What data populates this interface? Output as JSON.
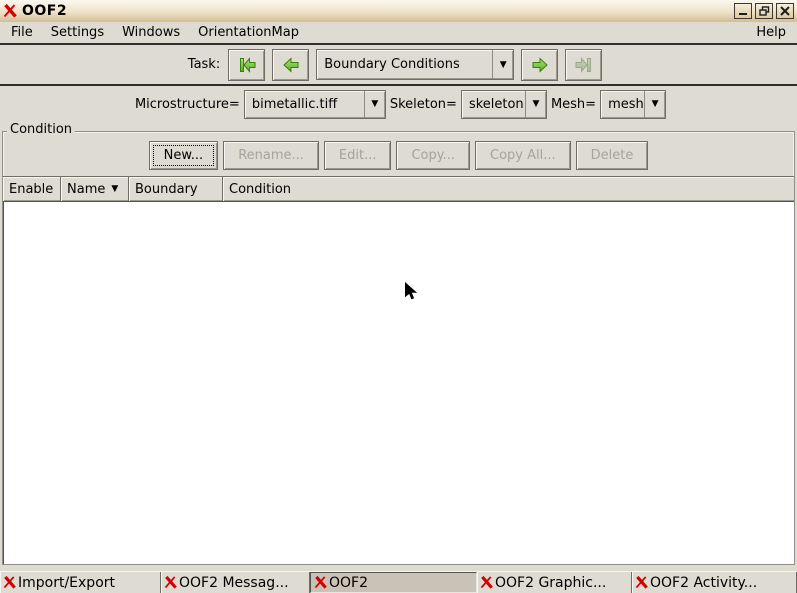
{
  "window": {
    "title": "OOF2"
  },
  "menubar": {
    "items": [
      "File",
      "Settings",
      "Windows",
      "OrientationMap"
    ],
    "help": "Help"
  },
  "task_row": {
    "label": "Task:",
    "selected_task": "Boundary Conditions"
  },
  "context_row": {
    "microstructure_label": "Microstructure=",
    "microstructure_value": "bimetallic.tiff",
    "skeleton_label": "Skeleton=",
    "skeleton_value": "skeleton",
    "mesh_label": "Mesh=",
    "mesh_value": "mesh"
  },
  "condition_panel": {
    "frame_label": "Condition",
    "buttons": [
      {
        "label": "New...",
        "enabled": true
      },
      {
        "label": "Rename...",
        "enabled": false
      },
      {
        "label": "Edit...",
        "enabled": false
      },
      {
        "label": "Copy...",
        "enabled": false
      },
      {
        "label": "Copy All...",
        "enabled": false
      },
      {
        "label": "Delete",
        "enabled": false
      }
    ],
    "columns": [
      "Enable",
      "Name",
      "Boundary",
      "Condition"
    ],
    "rows": []
  },
  "taskbar": {
    "windows": [
      {
        "label": "Import/Export",
        "active": false
      },
      {
        "label": "OOF2 Messag...",
        "active": false
      },
      {
        "label": "OOF2",
        "active": true
      },
      {
        "label": "OOF2 Graphic...",
        "active": false
      },
      {
        "label": "OOF2 Activity...",
        "active": false
      }
    ]
  },
  "icons": {
    "x11_logo": "red X window-system logo",
    "minimize": "minimize",
    "maximize": "maximize-restore",
    "close": "close",
    "combo_arrow": "▼",
    "sort_indicator": "▼",
    "nav_first": "skip-to-first green arrow",
    "nav_prev": "previous green arrow",
    "nav_next": "next green arrow",
    "nav_last": "skip-to-last green arrow (disabled)"
  },
  "colors": {
    "titlebar_tan": "#e8dcbf",
    "panel_bg": "#dedbd2",
    "accent_green": "#73c832",
    "logo_red": "#d40000",
    "disabled_text": "#a6a39a",
    "list_bg": "#ffffff",
    "active_taskbar_item": "#c9c3b7"
  }
}
